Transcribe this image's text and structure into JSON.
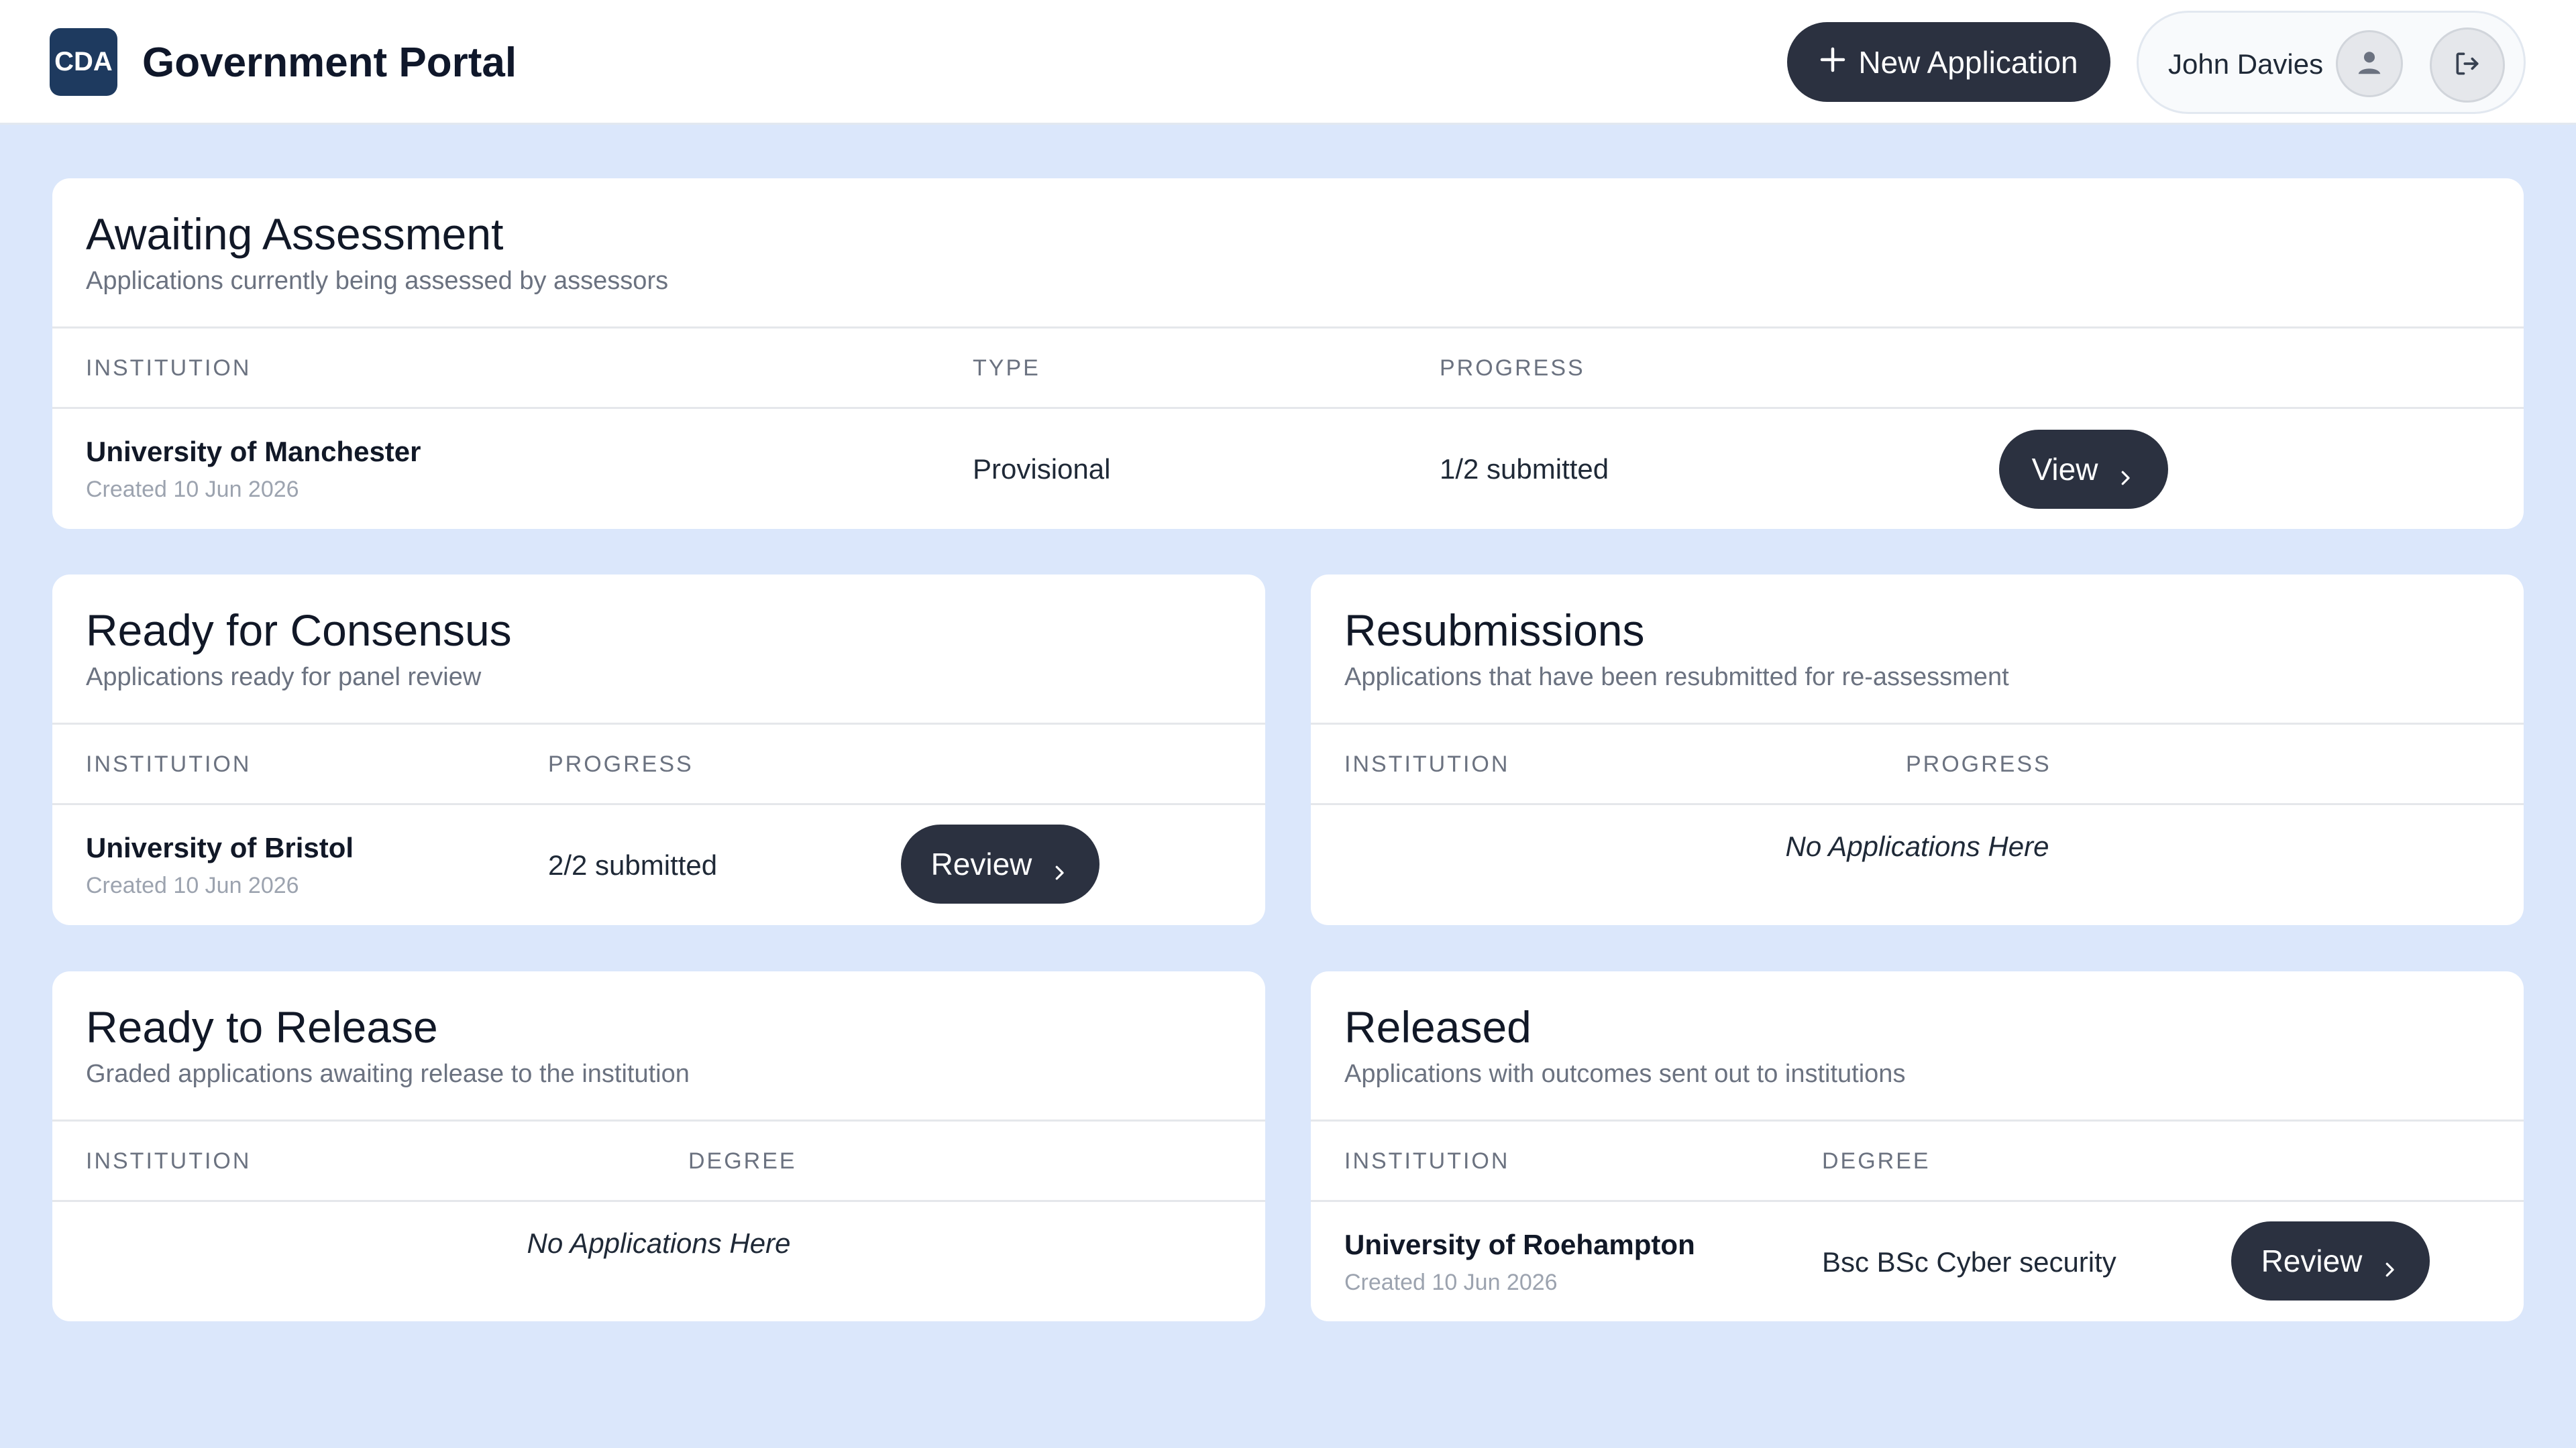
{
  "header": {
    "logo_text": "CDA",
    "title": "Government Portal",
    "new_application_label": "New Application",
    "user_name": "John Davies",
    "icons": {
      "avatar": "user-icon",
      "logout": "logout-icon",
      "new": "plus-icon"
    }
  },
  "awaiting_assessment": {
    "title": "Awaiting Assessment",
    "subtitle": "Applications currently being assessed by assessors",
    "columns": [
      "INSTITUTION",
      "TYPE",
      "PROGRESS"
    ],
    "rows": [
      {
        "institution": "University of Manchester",
        "created": "Created 10 Jun 2026",
        "type": "Provisional",
        "progress": "1/2 submitted",
        "action": "View"
      }
    ]
  },
  "ready_for_consensus": {
    "title": "Ready for Consensus",
    "subtitle": "Applications ready for panel review",
    "columns": [
      "INSTITUTION",
      "PROGRESS"
    ],
    "rows": [
      {
        "institution": "University of Bristol",
        "created": "Created 10 Jun 2026",
        "progress": "2/2 submitted",
        "action": "Review"
      }
    ]
  },
  "resubmissions": {
    "title": "Resubmissions",
    "subtitle": "Applications that have been resubmitted for re-assessment",
    "columns": [
      "INSTITUTION",
      "PROGRESS"
    ],
    "empty_text": "No Applications Here"
  },
  "ready_to_release": {
    "title": "Ready to Release",
    "subtitle": "Graded applications awaiting release to the institution",
    "columns": [
      "INSTITUTION",
      "DEGREE"
    ],
    "empty_text": "No Applications Here"
  },
  "released": {
    "title": "Released",
    "subtitle": "Applications with outcomes sent out to institutions",
    "columns": [
      "INSTITUTION",
      "DEGREE"
    ],
    "rows": [
      {
        "institution": "University of Roehampton",
        "created": "Created 10 Jun 2026",
        "degree": "Bsc BSc Cyber security",
        "action": "Review"
      }
    ]
  },
  "colors": {
    "page_bg": "#dbe7fb",
    "button_bg": "#2b3140",
    "logo_bg": "#1e3a5f"
  }
}
